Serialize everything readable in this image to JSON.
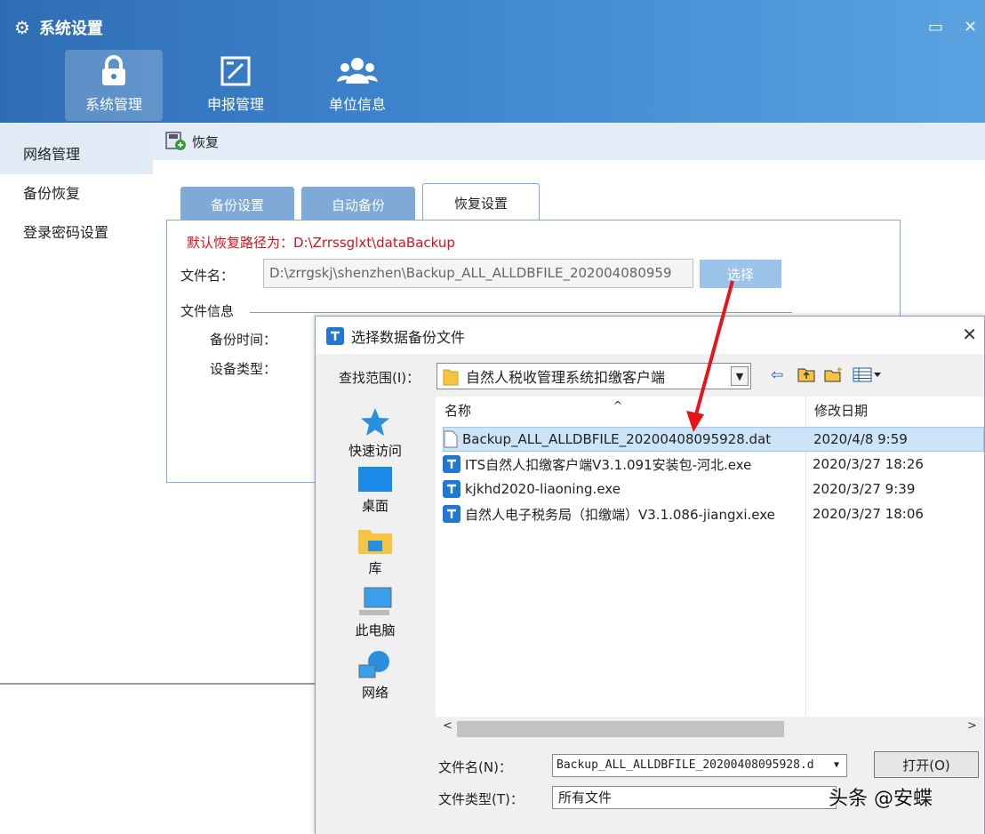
{
  "window": {
    "title": "系统设置",
    "nav": [
      {
        "label": "系统管理",
        "icon": "lock-icon"
      },
      {
        "label": "申报管理",
        "icon": "edit-form-icon"
      },
      {
        "label": "单位信息",
        "icon": "users-icon"
      }
    ]
  },
  "sidebar": {
    "items": [
      {
        "label": "网络管理"
      },
      {
        "label": "备份恢复"
      },
      {
        "label": "登录密码设置"
      }
    ]
  },
  "content": {
    "header": "恢复",
    "tabs": [
      {
        "label": "备份设置"
      },
      {
        "label": "自动备份"
      },
      {
        "label": "恢复设置"
      }
    ],
    "default_path": "默认恢复路径为：D:\\Zrrssglxt\\dataBackup",
    "file_name_label": "文件名：",
    "file_name_value": "D:\\zrrgskj\\shenzhen\\Backup_ALL_ALLDBFILE_202004080959",
    "choose_button": "选择",
    "file_info_label": "文件信息",
    "backup_time_label": "备份时间：",
    "backup_type_label": "设备类型："
  },
  "dialog": {
    "title": "选择数据备份文件",
    "look_in_label": "查找范围(I)：",
    "look_in_value": "自然人税收管理系统扣缴客户端",
    "places": [
      {
        "label": "快速访问",
        "icon": "star-icon"
      },
      {
        "label": "桌面",
        "icon": "desktop-icon"
      },
      {
        "label": "库",
        "icon": "library-icon"
      },
      {
        "label": "此电脑",
        "icon": "computer-icon"
      },
      {
        "label": "网络",
        "icon": "network-icon"
      }
    ],
    "columns": {
      "name": "名称",
      "modified": "修改日期"
    },
    "files": [
      {
        "name": "Backup_ALL_ALLDBFILE_20200408095928.dat",
        "date": "2020/4/8 9:59",
        "icon": "file-icon",
        "selected": true
      },
      {
        "name": "ITS自然人扣缴客户端V3.1.091安装包-河北.exe",
        "date": "2020/3/27 18:26",
        "icon": "installer-icon",
        "selected": false
      },
      {
        "name": "kjkhd2020-liaoning.exe",
        "date": "2020/3/27 9:39",
        "icon": "installer-icon",
        "selected": false
      },
      {
        "name": "自然人电子税务局（扣缴端）V3.1.086-jiangxi.exe",
        "date": "2020/3/27 18:06",
        "icon": "installer-icon",
        "selected": false
      }
    ],
    "file_name_label": "文件名(N)：",
    "file_name_value": "Backup_ALL_ALLDBFILE_20200408095928.d",
    "file_type_label": "文件类型(T)：",
    "file_type_value": "所有文件",
    "open_button": "打开(O)"
  },
  "watermark": "头条 @安蝶",
  "colors": {
    "accent": "#3f86cf",
    "tab": "#7fa9d6",
    "warning_text": "#d2141c",
    "arrow": "#e8141c"
  }
}
